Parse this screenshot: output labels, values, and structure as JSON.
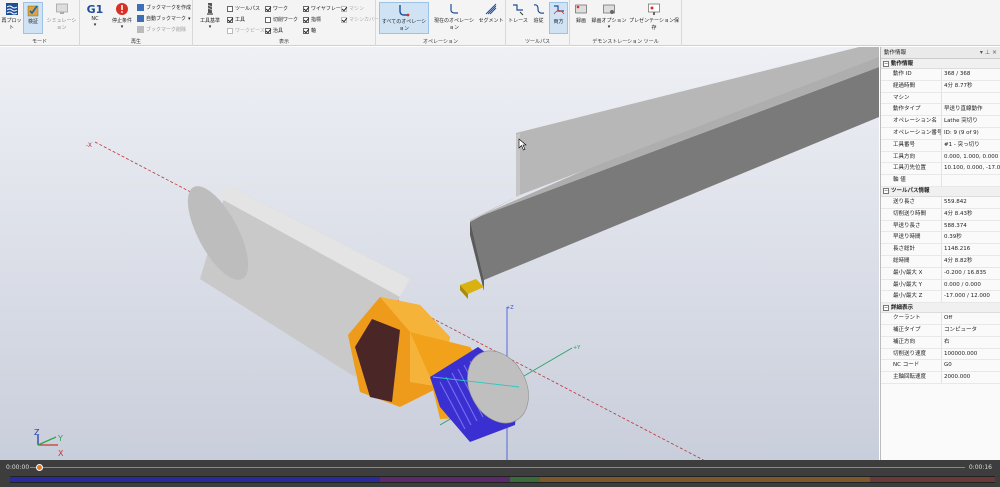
{
  "ribbon": {
    "mode": {
      "label": "モード",
      "replot": "再プロット",
      "verify": "検証",
      "simulation": "シミュレーション"
    },
    "playback": {
      "label": "再生",
      "g1": "G1",
      "nc": "NC",
      "stop_condition": "停止条件",
      "create_bookmark": "ブックマークを作成",
      "auto_bookmark": "自動ブックマーク",
      "delete_bookmark": "ブックマーク削除"
    },
    "display": {
      "label": "表示",
      "tool_library": "工具基準",
      "toolpath": "ツールパス",
      "tool": "工具",
      "workpiece": "ワークピース",
      "work": "ワーク",
      "cut_work": "切削ワーク",
      "fixture": "治具",
      "wireframe": "ワイヤフレーム",
      "indicator": "指標",
      "axis": "軸",
      "machine": "マシン",
      "machine_cover": "マシンカバー"
    },
    "operation": {
      "label": "オペレーション",
      "all_operations": "すべてのオペレーション",
      "current_operation": "現在のオペレーション",
      "segment": "セグメント"
    },
    "toolpath": {
      "label": "ツールパス",
      "trace": "トレース",
      "follow": "追従",
      "both": "両方"
    },
    "demo": {
      "label": "デモンストレーション ツール",
      "record": "録画",
      "record_options": "録画オプション",
      "save_presentation": "プレゼンテーション保存"
    }
  },
  "viewport": {
    "axis_x": "-X",
    "axis_y": "+Y",
    "axis_z": "+Z",
    "triad_z": "Z",
    "triad_y": "Y",
    "triad_x": "X"
  },
  "panel": {
    "title": "動作情報",
    "sections": [
      {
        "title": "動作情報",
        "rows": [
          {
            "k": "動作 ID",
            "v": "368 / 368"
          },
          {
            "k": "経過時間",
            "v": "4分 8.77秒"
          },
          {
            "k": "マシン",
            "v": ""
          },
          {
            "k": "動作タイプ",
            "v": "早送り直線動作"
          },
          {
            "k": "オペレーション名",
            "v": "Lathe 突切り"
          },
          {
            "k": "オペレーション番号",
            "v": "ID: 9 (9 of 9)"
          },
          {
            "k": "工具番号",
            "v": "#1 - 突っ切り"
          },
          {
            "k": "工具方向",
            "v": "0.000, 1.000, 0.000"
          },
          {
            "k": "工具刃先位置",
            "v": "10.100, 0.000, -17.000"
          },
          {
            "k": "軸 値",
            "v": ""
          }
        ]
      },
      {
        "title": "ツールパス情報",
        "rows": [
          {
            "k": "送り長さ",
            "v": "559.842"
          },
          {
            "k": "切削送り時間",
            "v": "4分 8.43秒"
          },
          {
            "k": "早送り長さ",
            "v": "588.374"
          },
          {
            "k": "早送り時間",
            "v": "0.39秒"
          },
          {
            "k": "長さ総計",
            "v": "1148.216"
          },
          {
            "k": "総時間",
            "v": "4分 8.82秒"
          },
          {
            "k": "最小/最大 X",
            "v": "-0.200 / 16.835"
          },
          {
            "k": "最小/最大 Y",
            "v": "0.000 / 0.000"
          },
          {
            "k": "最小/最大 Z",
            "v": "-17.000 / 12.000"
          }
        ]
      },
      {
        "title": "詳細表示",
        "rows": [
          {
            "k": "クーラント",
            "v": "Off"
          },
          {
            "k": "補正タイプ",
            "v": "コンピュータ"
          },
          {
            "k": "補正方向",
            "v": "右"
          },
          {
            "k": "切削送り速度",
            "v": "100000.000"
          },
          {
            "k": "NC コード",
            "v": "G0"
          },
          {
            "k": "主軸回転速度",
            "v": "2000.000"
          }
        ]
      }
    ]
  },
  "timeline": {
    "start": "0:00:00",
    "end": "0:00:16",
    "progress": 0.01
  },
  "colors": {
    "active_button": "#cfe3f5",
    "workpiece_orange": "#f2a21a",
    "thread_blue": "#3a2fd0",
    "knob": "#e07b2a"
  }
}
